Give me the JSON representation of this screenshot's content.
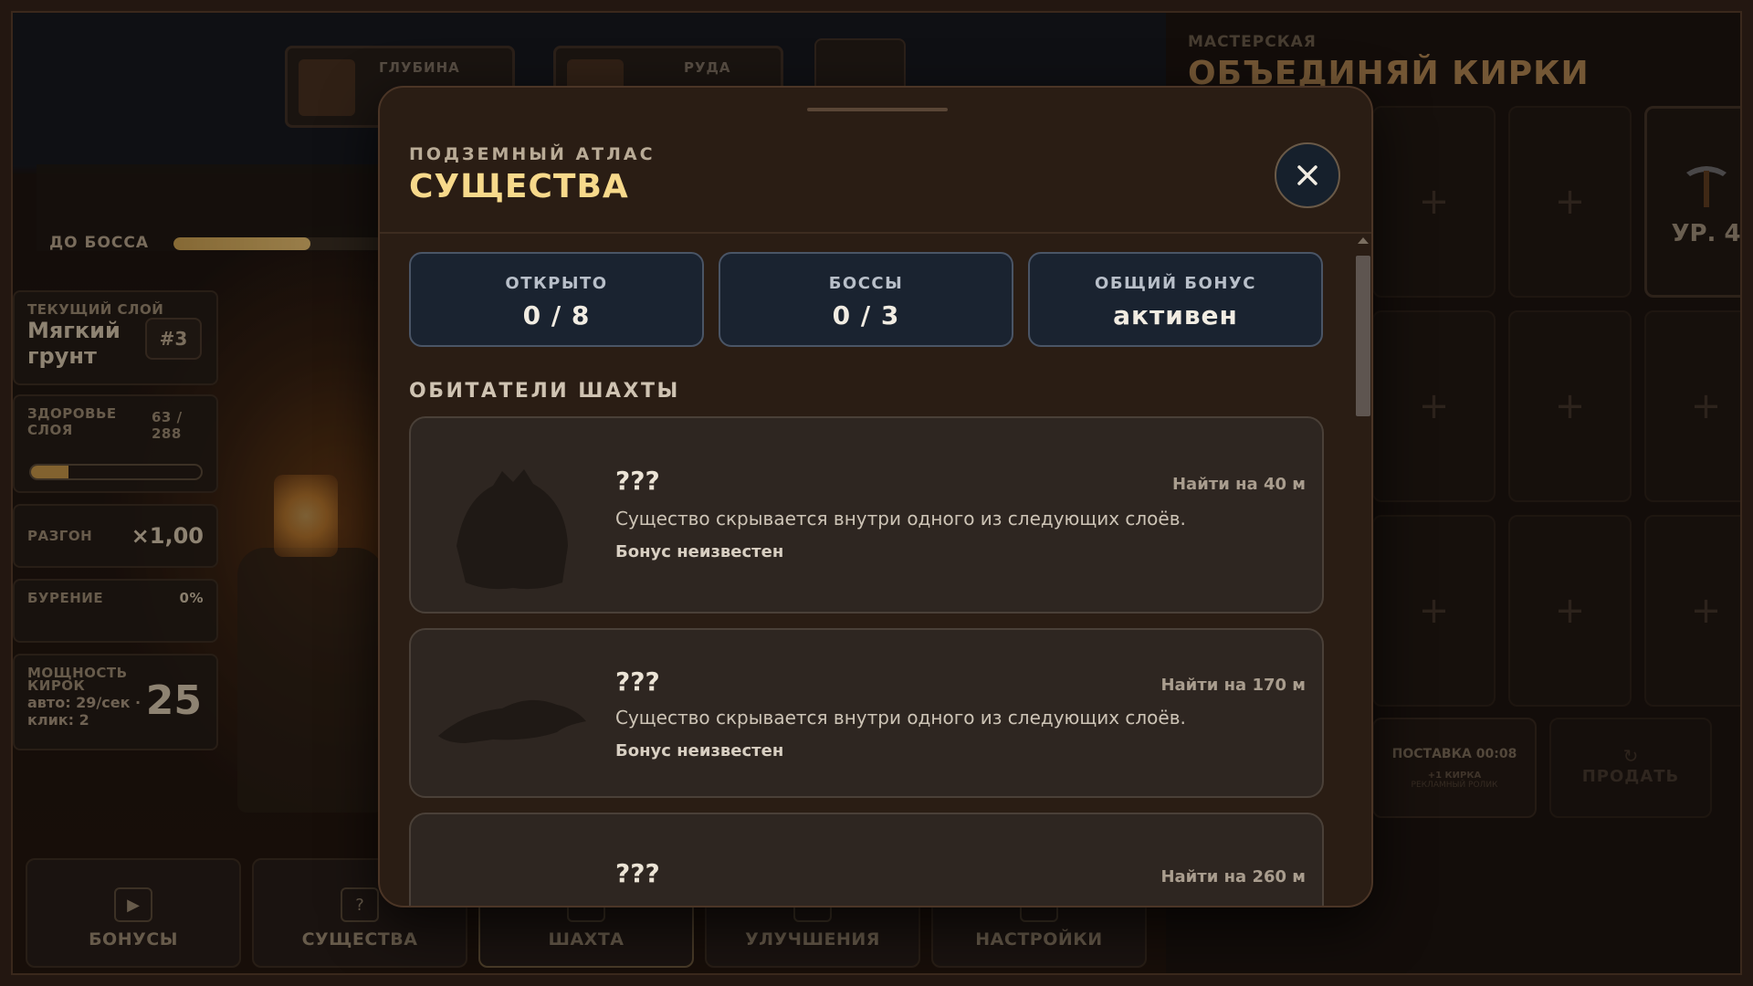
{
  "hud": {
    "top_tabs": [
      {
        "label": "ГЛУБИНА"
      },
      {
        "label": "РУДА"
      }
    ],
    "boss": {
      "label": "ДО БОССА",
      "progress": 0.65
    },
    "layer": {
      "kicker": "ТЕКУЩИЙ СЛОЙ",
      "name_line1": "Мягкий",
      "name_line2": "грунт",
      "badge": "#3"
    },
    "health": {
      "label_line1": "ЗДОРОВЬЕ",
      "label_line2": "СЛОЯ",
      "value_line1": "63 /",
      "value_line2": "288",
      "fraction": 0.22
    },
    "boost": {
      "label": "РАЗГОН",
      "value": "×1,00"
    },
    "drilling": {
      "label": "БУРЕНИЕ",
      "value": "0%"
    },
    "power": {
      "label_line1": "МОЩНОСТЬ",
      "label_line2": "КИРОК",
      "sub_line1": "авто: 29/сек ·",
      "sub_line2": "клик: 2",
      "value": "25"
    }
  },
  "bottom_nav": [
    {
      "label": "БОНУСЫ",
      "icon": "play-icon"
    },
    {
      "label": "СУЩЕСТВА",
      "icon": "question-icon"
    },
    {
      "label": "ШАХТА",
      "icon": "mine-icon"
    },
    {
      "label": "УЛУЧШЕНИЯ",
      "icon": "upgrade-icon"
    },
    {
      "label": "НАСТРОЙКИ",
      "icon": "settings-icon"
    }
  ],
  "workshop": {
    "kicker": "МАСТЕРСКАЯ",
    "title": "ОБЪЕДИНЯЙ КИРКИ",
    "slot_plus": "+",
    "level_label": "УР. 4",
    "supply": {
      "line1": "ПОСТАВКА 00:08",
      "line2": "+1 КИРКА",
      "line3": "РЕКЛАМНЫЙ РОЛИК"
    },
    "sell": {
      "icon": "↻",
      "label": "ПРОДАТЬ"
    }
  },
  "modal": {
    "kicker": "ПОДЗЕМНЫЙ АТЛАС",
    "title": "СУЩЕСТВА",
    "close_icon": "close-icon",
    "stats": [
      {
        "label": "ОТКРЫТО",
        "value": "0 / 8"
      },
      {
        "label": "БОССЫ",
        "value": "0 / 3"
      },
      {
        "label": "ОБЩИЙ БОНУС",
        "value": "активен"
      }
    ],
    "section_title": "ОБИТАТЕЛИ ШАХТЫ",
    "creatures": [
      {
        "name": "???",
        "find": "Найти на 40 м",
        "description": "Существо скрывается внутри одного из следующих слоёв.",
        "bonus": "Бонус неизвестен"
      },
      {
        "name": "???",
        "find": "Найти на 170 м",
        "description": "Существо скрывается внутри одного из следующих слоёв.",
        "bonus": "Бонус неизвестен"
      },
      {
        "name": "???",
        "find": "Найти на 260 м"
      }
    ]
  },
  "colors": {
    "accent": "#f7d98b",
    "modal_bg": "#2a1d14",
    "stat_bg": "#1a2330"
  }
}
